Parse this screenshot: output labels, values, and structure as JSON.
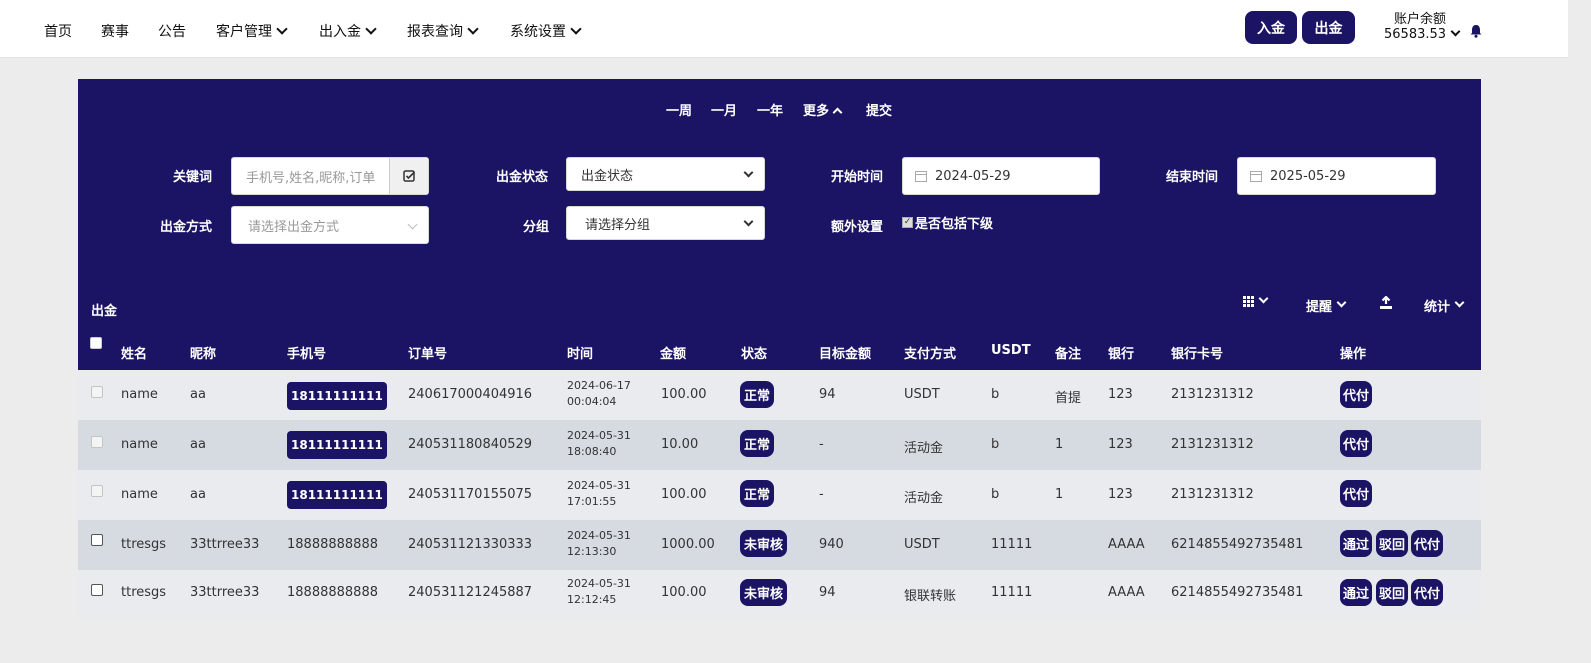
{
  "nav": {
    "home": "首页",
    "events": "赛事",
    "notice": "公告",
    "customer": "客户管理",
    "funds": "出入金",
    "reports": "报表查询",
    "settings": "系统设置"
  },
  "header": {
    "deposit_btn": "入金",
    "withdraw_btn": "出金",
    "balance_label": "账户余额",
    "balance_value": "56583.53"
  },
  "quick_ranges": {
    "week": "一周",
    "month": "一月",
    "year": "一年",
    "more": "更多",
    "submit": "提交"
  },
  "filters": {
    "keyword_label": "关键词",
    "keyword_placeholder": "手机号,姓名,昵称,订单",
    "status_label": "出金状态",
    "status_value": "出金状态",
    "start_label": "开始时间",
    "start_value": "2024-05-29",
    "end_label": "结束时间",
    "end_value": "2025-05-29",
    "method_label": "出金方式",
    "method_placeholder": "请选择出金方式",
    "group_label": "分组",
    "group_value": "请选择分组",
    "extra_label": "额外设置",
    "extra_checkbox": "是否包括下级"
  },
  "section": {
    "title": "出金",
    "remind": "提醒",
    "stats": "统计"
  },
  "table": {
    "headers": {
      "name": "姓名",
      "nick": "昵称",
      "phone": "手机号",
      "order": "订单号",
      "time": "时间",
      "amount": "金额",
      "status": "状态",
      "target": "目标金额",
      "pay": "支付方式",
      "usdt": "USDT",
      "note": "备注",
      "bank": "银行",
      "card": "银行卡号",
      "ops": "操作"
    },
    "rows": [
      {
        "name": "name",
        "nick": "aa",
        "phone": "18111111111",
        "order": "240617000404916",
        "date": "2024-06-17",
        "clock": "00:04:04",
        "amount": "100.00",
        "status": "正常",
        "target": "94",
        "pay": "USDT",
        "usdt": "b",
        "note": "首提",
        "bank": "123",
        "card": "2131231312",
        "a1": "代付"
      },
      {
        "name": "name",
        "nick": "aa",
        "phone": "18111111111",
        "order": "240531180840529",
        "date": "2024-05-31",
        "clock": "18:08:40",
        "amount": "10.00",
        "status": "正常",
        "target": "-",
        "pay": "活动金",
        "usdt": "b",
        "note": "1",
        "bank": "123",
        "card": "2131231312",
        "a1": "代付"
      },
      {
        "name": "name",
        "nick": "aa",
        "phone": "18111111111",
        "order": "240531170155075",
        "date": "2024-05-31",
        "clock": "17:01:55",
        "amount": "100.00",
        "status": "正常",
        "target": "-",
        "pay": "活动金",
        "usdt": "b",
        "note": "1",
        "bank": "123",
        "card": "2131231312",
        "a1": "代付"
      },
      {
        "name": "ttresgs",
        "nick": "33ttrree33",
        "phone": "18888888888",
        "order": "240531121330333",
        "date": "2024-05-31",
        "clock": "12:13:30",
        "amount": "1000.00",
        "status": "未审核",
        "target": "940",
        "pay": "USDT",
        "usdt": "11111",
        "note": "",
        "bank": "AAAA",
        "card": "6214855492735481",
        "a1": "通过",
        "a2": "驳回",
        "a3": "代付"
      },
      {
        "name": "ttresgs",
        "nick": "33ttrree33",
        "phone": "18888888888",
        "order": "240531121245887",
        "date": "2024-05-31",
        "clock": "12:12:45",
        "amount": "100.00",
        "status": "未审核",
        "target": "94",
        "pay": "银联转账",
        "usdt": "11111",
        "note": "",
        "bank": "AAAA",
        "card": "6214855492735481",
        "a1": "通过",
        "a2": "驳回",
        "a3": "代付"
      }
    ]
  },
  "colors": {
    "brand": "#1b1464",
    "row_light": "#e9ebef",
    "row_dark": "#d6dbe2"
  }
}
